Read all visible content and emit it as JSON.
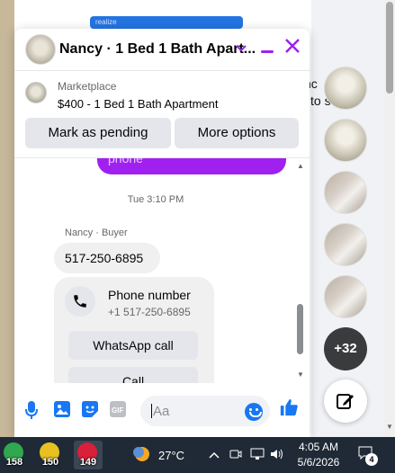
{
  "background": {
    "snippet_lines": [
      "nc",
      "l to s"
    ],
    "top_bubble_text": "realize"
  },
  "chat": {
    "title": "Nancy · 1 Bed 1 Bath Apart...",
    "marketplace": {
      "label": "Marketplace",
      "listing": "$400 - 1 Bed 1 Bath Apartment",
      "mark_pending": "Mark as pending",
      "more_options": "More options"
    },
    "messages": {
      "partial_outgoing": "phone",
      "timestamp": "Tue 3:10 PM",
      "sender": "Nancy · Buyer",
      "phone_text": "517-250-6895",
      "phone_card": {
        "title": "Phone number",
        "number": "+1 517-250-6895",
        "whatsapp_label": "WhatsApp call",
        "call_label": "Call"
      }
    },
    "composer": {
      "placeholder": "Aa"
    }
  },
  "rail": {
    "more_count": "+32"
  },
  "taskbar": {
    "apps": [
      {
        "badge": "158",
        "color": "#2fa84f"
      },
      {
        "badge": "150",
        "color": "#e8c020"
      },
      {
        "badge": "149",
        "color": "#d8203a"
      }
    ],
    "temperature": "27°C",
    "time": "4:05 AM",
    "date": "5/6/2026",
    "notification_count": "4"
  },
  "colors": {
    "accent": "#a020f0",
    "messenger_blue": "#1877f2"
  }
}
